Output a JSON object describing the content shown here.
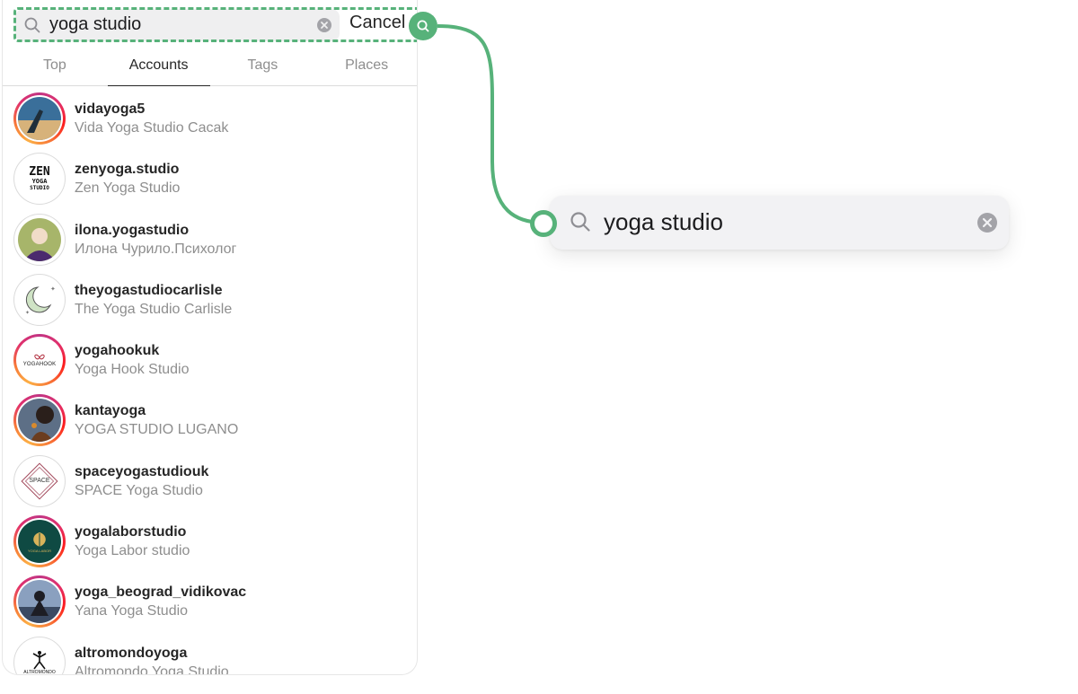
{
  "search": {
    "query": "yoga studio",
    "cancel_label": "Cancel"
  },
  "tabs": [
    {
      "label": "Top",
      "active": false
    },
    {
      "label": "Accounts",
      "active": true
    },
    {
      "label": "Tags",
      "active": false
    },
    {
      "label": "Places",
      "active": false
    }
  ],
  "accounts": [
    {
      "username": "vidayoga5",
      "name": "Vida Yoga Studio Cacak"
    },
    {
      "username": "zenyoga.studio",
      "name": "Zen Yoga Studio"
    },
    {
      "username": "ilona.yogastudio",
      "name": "Илона Чурило.Психолог"
    },
    {
      "username": "theyogastudiocarlisle",
      "name": "The Yoga Studio Carlisle"
    },
    {
      "username": "yogahookuk",
      "name": "Yoga Hook Studio"
    },
    {
      "username": "kantayoga",
      "name": "YOGA STUDIO LUGANO"
    },
    {
      "username": "spaceyogastudiouk",
      "name": "SPACE Yoga Studio"
    },
    {
      "username": "yogalaborstudio",
      "name": "Yoga Labor studio"
    },
    {
      "username": "yoga_beograd_vidikovac",
      "name": "Yana Yoga Studio"
    },
    {
      "username": "altromondoyoga",
      "name": "Altromondo Yoga Studio"
    }
  ],
  "avatars": {
    "zen_text_1": "ZEN",
    "zen_text_2": "YOGA",
    "zen_text_3": "STUDIO",
    "yogahook_text": "YOGAHOOK",
    "space_text": "SPACE",
    "yogalabor_text": "YOGA LABOR",
    "altromondo_text": "ALTROMONDO"
  },
  "zoom": {
    "query": "yoga studio"
  },
  "colors": {
    "accent": "#57b27a",
    "muted": "#8e8e8e",
    "text": "#262626"
  }
}
